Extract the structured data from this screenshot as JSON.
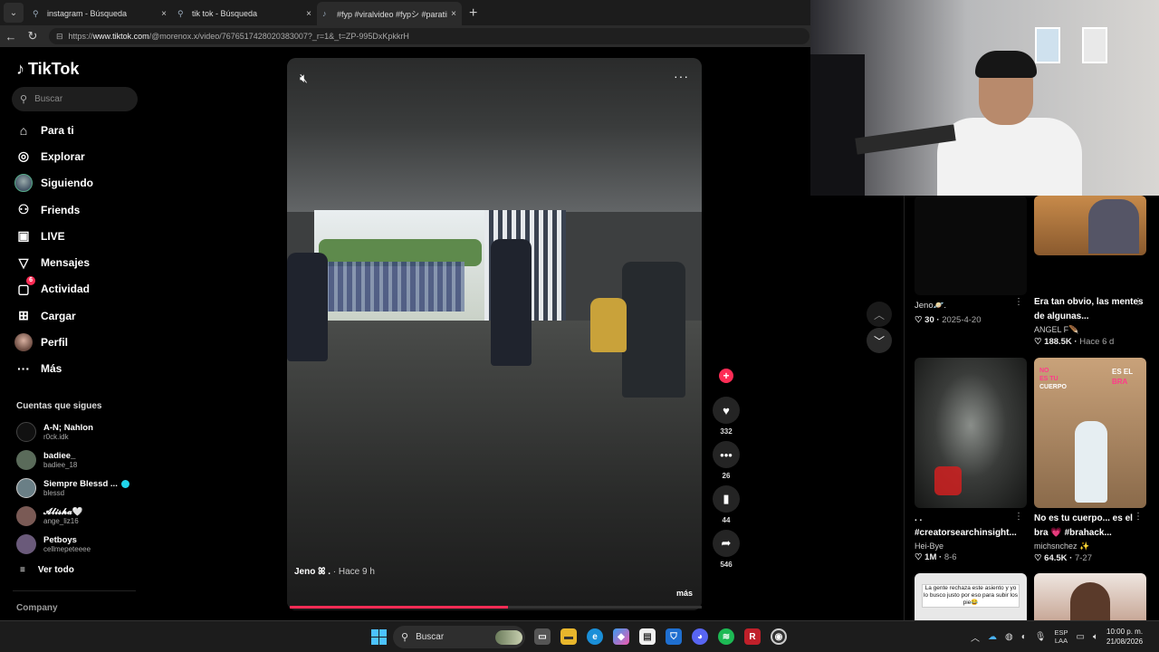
{
  "browser": {
    "tabs": [
      {
        "label": "instagram - Búsqueda",
        "icon": "search-icon"
      },
      {
        "label": "tik tok - Búsqueda",
        "icon": "search-icon"
      },
      {
        "label": "#fyp #viralvideo #fypシ #paratii #F",
        "icon": "tiktok-icon"
      }
    ],
    "close": "×",
    "new_tab": "+",
    "url_prefix": "https://",
    "url_host": "www.tiktok.com",
    "url_path": "/@morenox.x/video/7676517428020383007?_r=1&_t=ZP-995DxKpkkrH"
  },
  "tiktok": {
    "logo": "TikTok",
    "search_placeholder": "Buscar",
    "nav": [
      {
        "label": "Para ti",
        "icon": "home-icon"
      },
      {
        "label": "Explorar",
        "icon": "compass-icon"
      },
      {
        "label": "Siguiendo",
        "icon": "avatar"
      },
      {
        "label": "Friends",
        "icon": "friends-icon"
      },
      {
        "label": "LIVE",
        "icon": "live-icon"
      },
      {
        "label": "Mensajes",
        "icon": "send-icon"
      },
      {
        "label": "Actividad",
        "icon": "activity-icon",
        "badge": "6"
      },
      {
        "label": "Cargar",
        "icon": "upload-icon"
      },
      {
        "label": "Perfil",
        "icon": "avatar"
      },
      {
        "label": "Más",
        "icon": "more-icon"
      }
    ],
    "following_heading": "Cuentas que sigues",
    "following": [
      {
        "name": "A-N; Nahlon",
        "handle": "r0ck.idk",
        "color": "#111111"
      },
      {
        "name": "badiee_",
        "handle": "badiee_18",
        "color": "#5a6b5a"
      },
      {
        "name": "Siempre Blessd ...",
        "handle": "blessd",
        "color": "#6a7f86",
        "verified": true
      },
      {
        "name": "𝓐𝓵𝓲𝓼𝓱𝓪🤍",
        "handle": "ange_liz16",
        "color": "#7a5a55"
      },
      {
        "name": "Petboys",
        "handle": "cellmepeteeee",
        "color": "#6a5a7a"
      }
    ],
    "see_all": "Ver todo",
    "company": "Company"
  },
  "video": {
    "author": "Jeno ꕤ .",
    "time": "· Hace 9 h",
    "more": "más",
    "progress": 0.53,
    "likes": "332",
    "comments": "26",
    "saves": "44",
    "shares": "546"
  },
  "grid": [
    {
      "title": "Jeno🪐.",
      "author": "",
      "likes": "30",
      "date": "2025-4-20"
    },
    {
      "title": "Era tan obvio, las mentes de algunas...",
      "author": "ANGEL F🪶",
      "likes": "188.5K",
      "date": "Hace 6 d"
    },
    {
      "title": ". .\n#creatorsearchinsight...",
      "author": "Hei-Bye",
      "likes": "1M",
      "date": "8-6"
    },
    {
      "title": "No es tu cuerpo... es el bra 💗 #brahack...",
      "author": "michsnchez ✨",
      "likes": "64.5K",
      "date": "7-27"
    }
  ],
  "thumb_text": {
    "no": "NO",
    "es_el": "ES EL",
    "es_tu": "ES TU",
    "cuerpo": "CUERPO",
    "bra": "BRA",
    "caption": "La gente rechaza este asiento y yo lo busco justo por eso para subir los pie😂"
  },
  "taskbar": {
    "search": "Buscar",
    "lang_top": "ESP",
    "lang_bottom": "LAA",
    "time": "10:00 p. m.",
    "date": "21/08/2026"
  },
  "colors": {
    "accent": "#fe2c55",
    "verified": "#20d5ec"
  }
}
